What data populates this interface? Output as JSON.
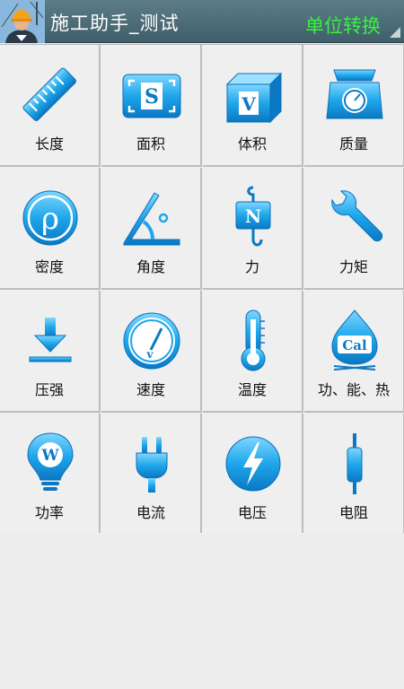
{
  "header": {
    "title": "施工助手_测试",
    "menu_label": "单位转换"
  },
  "colors": {
    "header_bg": "#4b6b76",
    "menu_label": "#39f23f",
    "icon_blue": "#1da4e8"
  },
  "units": [
    {
      "label": "长度",
      "icon": "ruler-icon"
    },
    {
      "label": "面积",
      "icon": "area-icon"
    },
    {
      "label": "体积",
      "icon": "volume-icon"
    },
    {
      "label": "质量",
      "icon": "scale-icon"
    },
    {
      "label": "密度",
      "icon": "density-icon"
    },
    {
      "label": "角度",
      "icon": "angle-icon"
    },
    {
      "label": "力",
      "icon": "force-icon"
    },
    {
      "label": "力矩",
      "icon": "wrench-icon"
    },
    {
      "label": "压强",
      "icon": "pressure-icon"
    },
    {
      "label": "速度",
      "icon": "speedometer-icon"
    },
    {
      "label": "温度",
      "icon": "thermometer-icon"
    },
    {
      "label": "功、能、热",
      "icon": "energy-icon"
    },
    {
      "label": "功率",
      "icon": "lightbulb-icon"
    },
    {
      "label": "电流",
      "icon": "plug-icon"
    },
    {
      "label": "电压",
      "icon": "lightning-icon"
    },
    {
      "label": "电阻",
      "icon": "resistor-icon"
    }
  ],
  "icon_letters": {
    "area": "S",
    "volume": "V",
    "density": "ρ",
    "force": "N",
    "energy": "Cal",
    "power": "W"
  }
}
